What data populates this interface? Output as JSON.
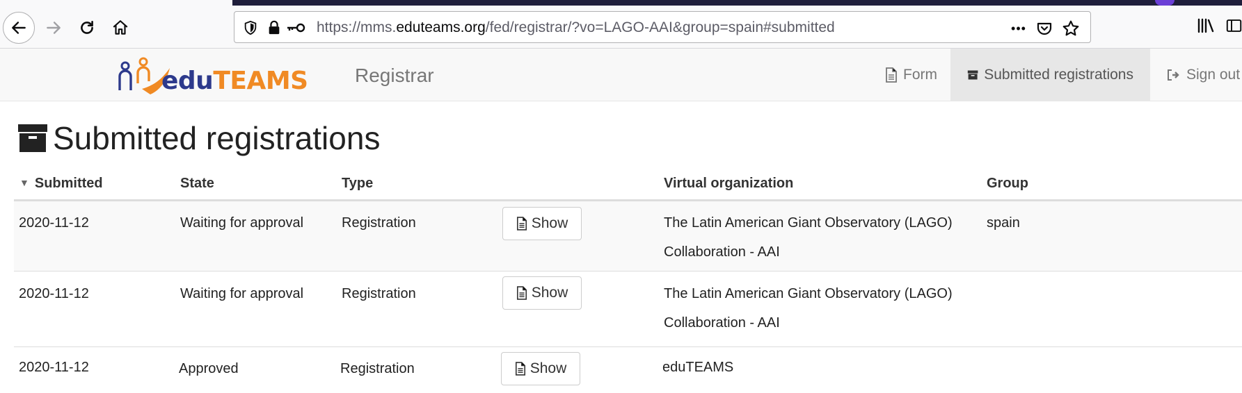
{
  "browser": {
    "url_prefix": "https://mms.",
    "url_domain": "eduteams.org",
    "url_suffix": "/fed/registrar/?vo=LAGO-AAI&group=spain#submitted",
    "icons": [
      "back-arrow-icon",
      "forward-arrow-icon",
      "reload-icon",
      "home-icon",
      "shield-icon",
      "lock-icon",
      "key-icon",
      "more-dots-icon",
      "pocket-icon",
      "star-icon",
      "library-icon",
      "sidebar-icon"
    ],
    "more_label": "•••"
  },
  "appnav": {
    "logo_edu": "edu",
    "logo_teams": "TEAMS",
    "brand": "Registrar",
    "links": {
      "form": "Form",
      "submitted": "Submitted registrations",
      "signout": "Sign out"
    }
  },
  "page": {
    "title": "Submitted registrations"
  },
  "table": {
    "sort_indicator": "▼",
    "headers": {
      "submitted": "Submitted",
      "state": "State",
      "type": "Type",
      "vo": "Virtual organization",
      "group": "Group"
    },
    "show_label": "Show",
    "rows": [
      {
        "submitted": "2020-11-12",
        "state": "Waiting for approval",
        "type": "Registration",
        "vo_line1": "The Latin American Giant Observatory (LAGO)",
        "vo_line2": "Collaboration - AAI",
        "group": "spain"
      },
      {
        "submitted": "2020-11-12",
        "state": "Waiting for approval",
        "type": "Registration",
        "vo_line1": "The Latin American Giant Observatory (LAGO)",
        "vo_line2": "Collaboration - AAI",
        "group": ""
      },
      {
        "submitted": "2020-11-12",
        "state": "Approved",
        "type": "Registration",
        "vo_line1": "eduTEAMS",
        "vo_line2": "",
        "group": ""
      }
    ]
  },
  "colors": {
    "logo_blue": "#2d3a8c",
    "logo_orange": "#f08a24",
    "nav_active_bg": "#e7e7e7",
    "row_stripe": "#f9f9f9"
  }
}
